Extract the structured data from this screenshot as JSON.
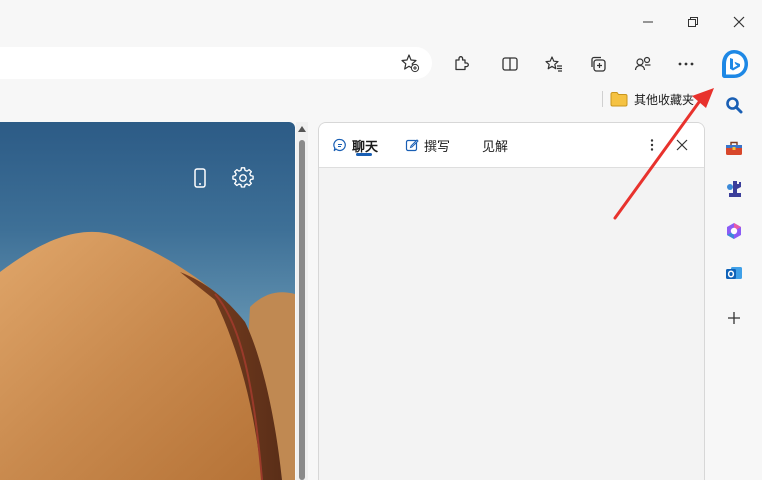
{
  "window_controls": {
    "minimize_icon": "minimize-icon",
    "restore_icon": "restore-icon",
    "close_icon": "close-icon"
  },
  "address_bar": {
    "value": "",
    "favorite_icon": "star-plus-icon"
  },
  "toolbar": {
    "icons": [
      "extensions-icon",
      "split-screen-icon",
      "favorites-icon",
      "collections-icon",
      "profile-switch-icon",
      "more-icon",
      "bing-copilot-icon"
    ]
  },
  "favorites_bar": {
    "folder_label": "其他收藏夹"
  },
  "sidebar_panel": {
    "tabs": [
      {
        "label": "聊天",
        "icon": "chat-icon"
      },
      {
        "label": "撰写",
        "icon": "compose-icon"
      },
      {
        "label": "见解",
        "icon": ""
      }
    ],
    "more_icon": "more-vertical-icon",
    "close_icon": "close-icon"
  },
  "rail": {
    "icons": [
      "search-icon",
      "tools-icon",
      "games-icon",
      "office-icon",
      "outlook-icon",
      "add-icon"
    ]
  },
  "colors": {
    "accent": "#1a5fb4",
    "arrow": "#e8322d",
    "bing_blue": "#1e88e5"
  }
}
